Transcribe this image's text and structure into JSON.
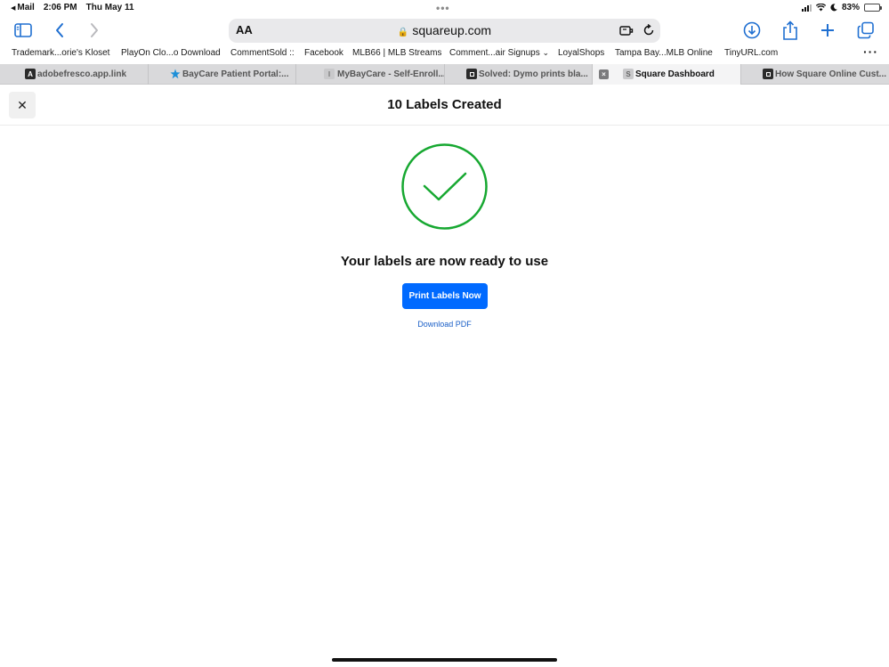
{
  "status_bar": {
    "back_app": "Mail",
    "time": "2:06 PM",
    "date": "Thu May 11",
    "battery": "83%",
    "battery_level": 0.83
  },
  "toolbar": {
    "aa_label": "AA",
    "url": "squareup.com"
  },
  "bookmarks": [
    "Trademark...orie's Kloset",
    "PlayOn Clo...o Download",
    "CommentSold ::",
    "Facebook",
    "MLB66 | MLB Streams",
    "Comment...air Signups",
    "LoyalShops",
    "Tampa Bay...MLB Online",
    "TinyURL.com"
  ],
  "tabs": [
    {
      "title": "adobefresco.app.link",
      "favicon": "A"
    },
    {
      "title": "BayCare Patient Portal:...",
      "favicon": ""
    },
    {
      "title": "MyBayCare - Self-Enroll...",
      "favicon": "I"
    },
    {
      "title": "Solved: Dymo prints bla...",
      "favicon": ""
    },
    {
      "title": "Square Dashboard",
      "favicon": "S"
    },
    {
      "title": "How Square Online Cust...",
      "favicon": ""
    }
  ],
  "page": {
    "title": "10 Labels Created",
    "message": "Your labels are now ready to use",
    "print_button": "Print Labels Now",
    "download_link": "Download PDF"
  },
  "colors": {
    "accent": "#006aff",
    "success": "#17a831",
    "link": "#1a5fc7"
  }
}
